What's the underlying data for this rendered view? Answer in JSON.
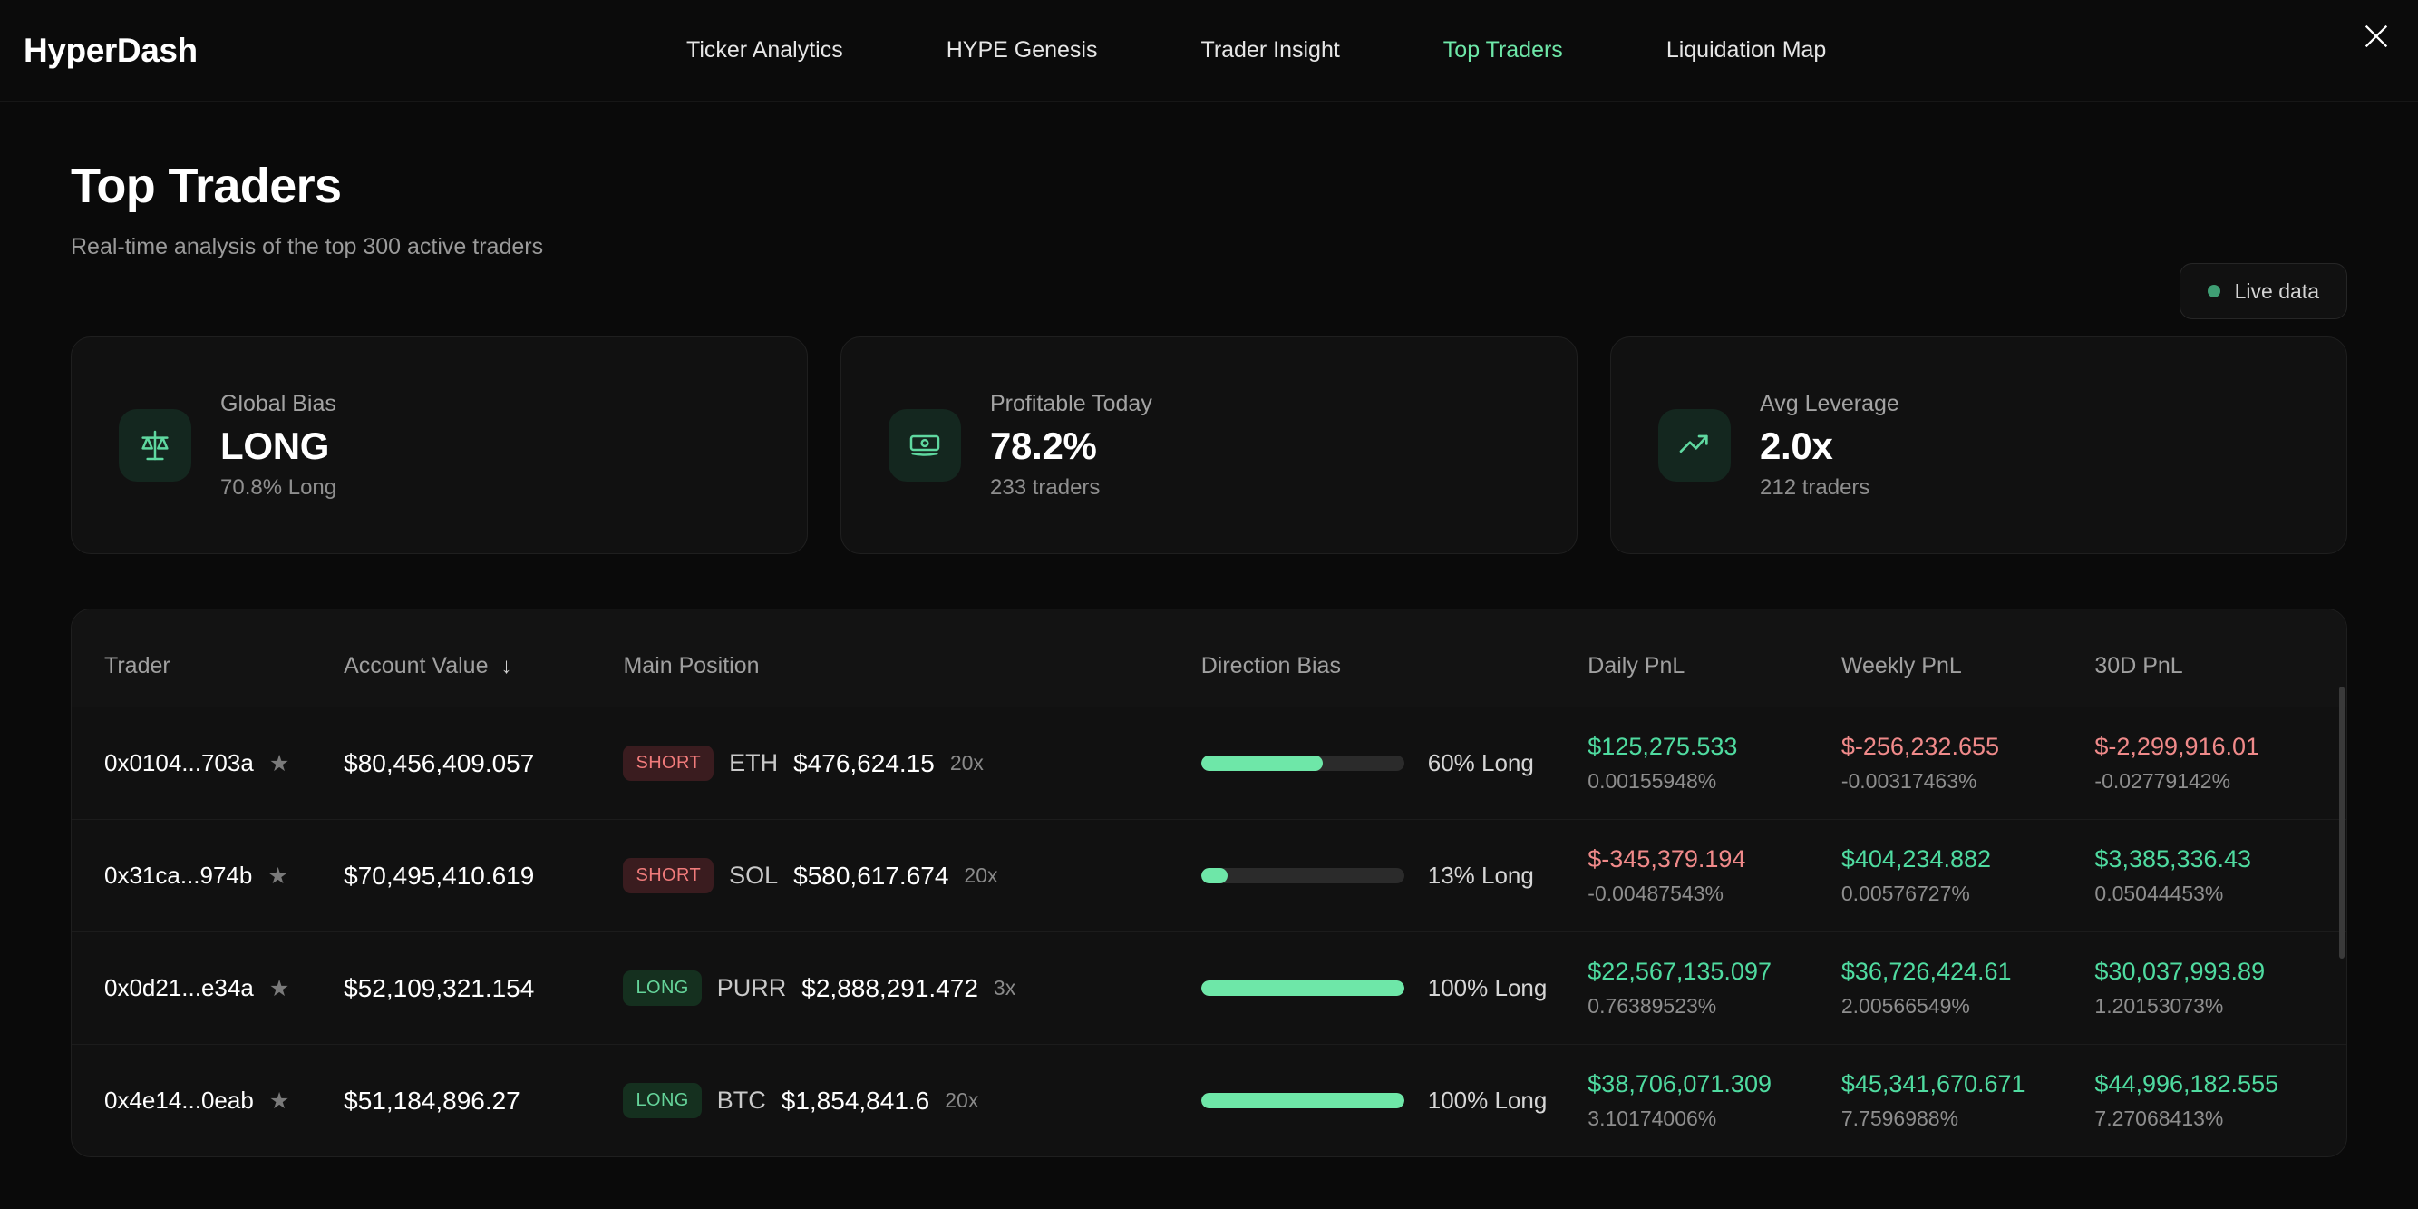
{
  "nav": {
    "brand": "HyperDash",
    "items": [
      {
        "label": "Ticker Analytics",
        "active": false
      },
      {
        "label": "HYPE Genesis",
        "active": false
      },
      {
        "label": "Trader Insight",
        "active": false
      },
      {
        "label": "Top Traders",
        "active": true
      },
      {
        "label": "Liquidation Map",
        "active": false
      }
    ],
    "close_icon": "x-icon"
  },
  "header": {
    "title": "Top Traders",
    "subtitle": "Real-time analysis of the top 300 active traders",
    "live_badge": "Live data"
  },
  "stats": [
    {
      "icon": "scales-icon",
      "label": "Global Bias",
      "value": "LONG",
      "meta": "70.8% Long"
    },
    {
      "icon": "banknote-icon",
      "label": "Profitable Today",
      "value": "78.2%",
      "meta": "233 traders"
    },
    {
      "icon": "trending-up-icon",
      "label": "Avg Leverage",
      "value": "2.0x",
      "meta": "212 traders"
    }
  ],
  "table": {
    "columns": [
      {
        "label": "Trader",
        "sorted": false
      },
      {
        "label": "Account Value",
        "sorted": true,
        "sort_dir": "↓"
      },
      {
        "label": "Main Position",
        "sorted": false
      },
      {
        "label": "Direction Bias",
        "sorted": false
      },
      {
        "label": "Daily PnL",
        "sorted": false
      },
      {
        "label": "Weekly PnL",
        "sorted": false
      },
      {
        "label": "30D PnL",
        "sorted": false
      }
    ],
    "rows": [
      {
        "trader": "0x0104...703a",
        "starred": true,
        "account_value": "$80,456,409.057",
        "position": {
          "side": "SHORT",
          "symbol": "ETH",
          "size": "$476,624.15",
          "leverage": "20x"
        },
        "bias": {
          "pct": 60,
          "label": "60% Long"
        },
        "daily": {
          "value": "$125,275.533",
          "pct": "0.00155948%",
          "positive": true
        },
        "weekly": {
          "value": "$-256,232.655",
          "pct": "-0.00317463%",
          "positive": false
        },
        "thirty": {
          "value": "$-2,299,916.01",
          "pct": "-0.02779142%",
          "positive": false
        }
      },
      {
        "trader": "0x31ca...974b",
        "starred": true,
        "account_value": "$70,495,410.619",
        "position": {
          "side": "SHORT",
          "symbol": "SOL",
          "size": "$580,617.674",
          "leverage": "20x"
        },
        "bias": {
          "pct": 13,
          "label": "13% Long"
        },
        "daily": {
          "value": "$-345,379.194",
          "pct": "-0.00487543%",
          "positive": false
        },
        "weekly": {
          "value": "$404,234.882",
          "pct": "0.00576727%",
          "positive": true
        },
        "thirty": {
          "value": "$3,385,336.43",
          "pct": "0.05044453%",
          "positive": true
        }
      },
      {
        "trader": "0x0d21...e34a",
        "starred": true,
        "account_value": "$52,109,321.154",
        "position": {
          "side": "LONG",
          "symbol": "PURR",
          "size": "$2,888,291.472",
          "leverage": "3x"
        },
        "bias": {
          "pct": 100,
          "label": "100% Long"
        },
        "daily": {
          "value": "$22,567,135.097",
          "pct": "0.76389523%",
          "positive": true
        },
        "weekly": {
          "value": "$36,726,424.61",
          "pct": "2.00566549%",
          "positive": true
        },
        "thirty": {
          "value": "$30,037,993.89",
          "pct": "1.20153073%",
          "positive": true
        }
      },
      {
        "trader": "0x4e14...0eab",
        "starred": true,
        "account_value": "$51,184,896.27",
        "position": {
          "side": "LONG",
          "symbol": "BTC",
          "size": "$1,854,841.6",
          "leverage": "20x"
        },
        "bias": {
          "pct": 100,
          "label": "100% Long"
        },
        "daily": {
          "value": "$38,706,071.309",
          "pct": "3.10174006%",
          "positive": true
        },
        "weekly": {
          "value": "$45,341,670.671",
          "pct": "7.7596988%",
          "positive": true
        },
        "thirty": {
          "value": "$44,996,182.555",
          "pct": "7.27068413%",
          "positive": true
        }
      }
    ]
  },
  "colors": {
    "accent_green": "#6ee7a8",
    "positive": "#4fdba0",
    "negative": "#f08a8a",
    "badge_long_bg": "#15301f",
    "badge_short_bg": "#3a1c1f",
    "background": "#0a0a0a",
    "card": "#111111"
  }
}
